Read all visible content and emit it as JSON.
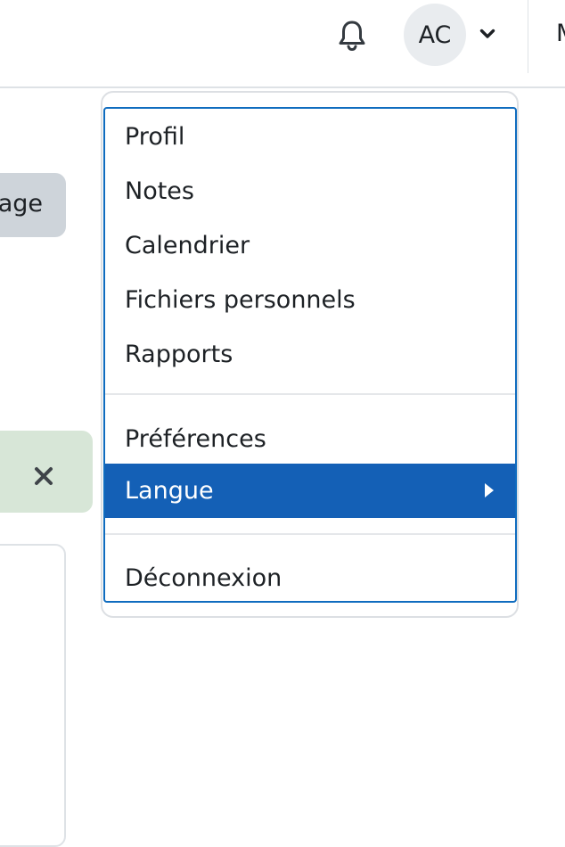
{
  "navbar": {
    "avatar_initials": "AC",
    "cut_off_text": "M",
    "icons": {
      "notifications": "bell-icon",
      "user_menu_toggle": "chevron-down-icon"
    }
  },
  "background": {
    "button_fragment_label": "age",
    "alert_close_icon": "close-icon"
  },
  "user_menu": {
    "items": [
      {
        "label": "Profil"
      },
      {
        "label": "Notes"
      },
      {
        "label": "Calendrier"
      },
      {
        "label": "Fichiers personnels"
      },
      {
        "label": "Rapports"
      },
      {
        "label": "Préférences"
      },
      {
        "label": "Langue",
        "active": true,
        "has_submenu": true
      },
      {
        "label": "Déconnexion"
      }
    ]
  },
  "colors": {
    "active_item_bg": "#1460b6",
    "focus_border": "#0f6cbf",
    "alert_bg": "#d7e6d7",
    "secondary_button_bg": "#ced4da"
  }
}
